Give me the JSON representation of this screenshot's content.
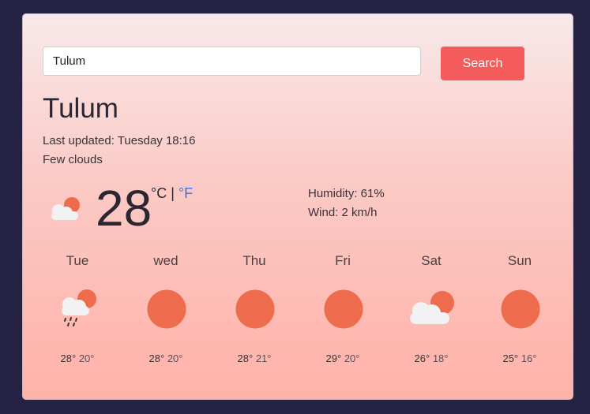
{
  "search": {
    "value": "Tulum",
    "button_label": "Search"
  },
  "current": {
    "city": "Tulum",
    "last_updated": "Last updated: Tuesday 18:16",
    "description": "Few clouds",
    "icon": "partly-cloudy-icon",
    "temperature": "28",
    "unit_celsius": "°C",
    "unit_separator": "|",
    "unit_fahrenheit": "°F",
    "humidity": "Humidity: 61%",
    "wind": "Wind: 2 km/h"
  },
  "forecast": [
    {
      "day": "Tue",
      "icon": "rain-cloud-sun-icon",
      "max": "28°",
      "min": "20°"
    },
    {
      "day": "wed",
      "icon": "sun-icon",
      "max": "28°",
      "min": "20°"
    },
    {
      "day": "Thu",
      "icon": "sun-icon",
      "max": "28°",
      "min": "21°"
    },
    {
      "day": "Fri",
      "icon": "sun-icon",
      "max": "29°",
      "min": "20°"
    },
    {
      "day": "Sat",
      "icon": "partly-cloudy-icon",
      "max": "26°",
      "min": "18°"
    },
    {
      "day": "Sun",
      "icon": "sun-icon",
      "max": "25°",
      "min": "16°"
    }
  ],
  "colors": {
    "background": "#262244",
    "accent": "#f45b5b",
    "sun": "#ee6c4d",
    "cloud": "#f2f2f2",
    "link": "#3f74e8"
  }
}
